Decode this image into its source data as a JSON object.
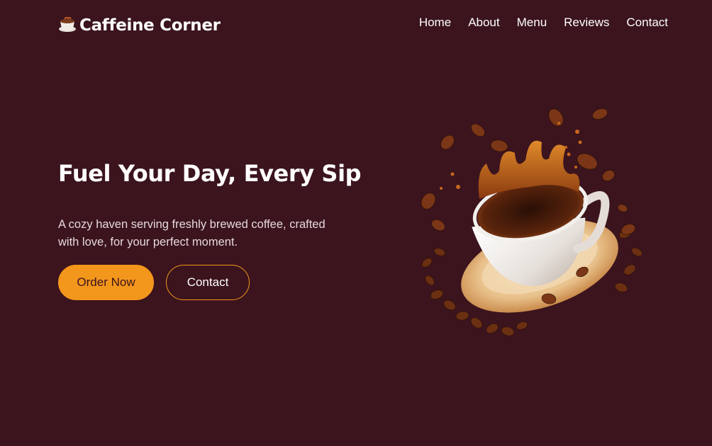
{
  "brand": {
    "logo_icon": "coffee-cup-icon",
    "name": "Caffeine Corner"
  },
  "nav": {
    "items": [
      {
        "label": "Home"
      },
      {
        "label": "About"
      },
      {
        "label": "Menu"
      },
      {
        "label": "Reviews"
      },
      {
        "label": "Contact"
      }
    ]
  },
  "hero": {
    "title": "Fuel Your Day, Every Sip",
    "description": "A cozy haven serving freshly brewed coffee, crafted with love, for your perfect moment.",
    "order_button": "Order Now",
    "contact_button": "Contact",
    "image_icon": "coffee-splash-illustration"
  },
  "colors": {
    "background": "#3b141d",
    "accent": "#f3961c",
    "text": "#ffffff"
  }
}
